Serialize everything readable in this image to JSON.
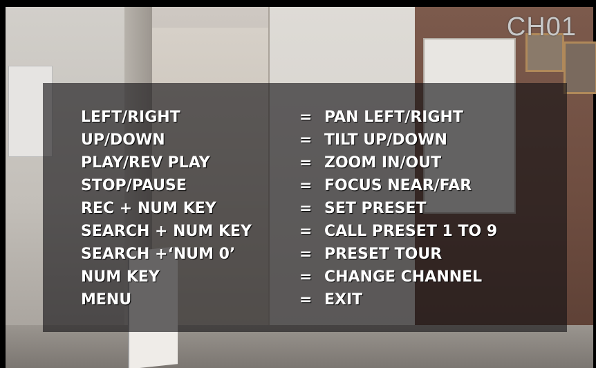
{
  "channel": {
    "label": "CH01"
  },
  "osd": {
    "rows": [
      {
        "key": "LEFT/RIGHT",
        "eq": "=",
        "action": "PAN LEFT/RIGHT"
      },
      {
        "key": "UP/DOWN",
        "eq": "=",
        "action": "TILT UP/DOWN"
      },
      {
        "key": "PLAY/REV PLAY",
        "eq": "=",
        "action": "ZOOM IN/OUT"
      },
      {
        "key": "STOP/PAUSE",
        "eq": "=",
        "action": "FOCUS NEAR/FAR"
      },
      {
        "key": "REC + NUM KEY",
        "eq": "=",
        "action": "SET PRESET"
      },
      {
        "key": "SEARCH + NUM KEY",
        "eq": "=",
        "action": "CALL PRESET 1 TO 9"
      },
      {
        "key": "SEARCH +‘NUM 0’",
        "eq": "=",
        "action": "PRESET TOUR"
      },
      {
        "key": "NUM KEY",
        "eq": "=",
        "action": "CHANGE CHANNEL"
      },
      {
        "key": "MENU",
        "eq": "=",
        "action": "EXIT"
      }
    ]
  }
}
